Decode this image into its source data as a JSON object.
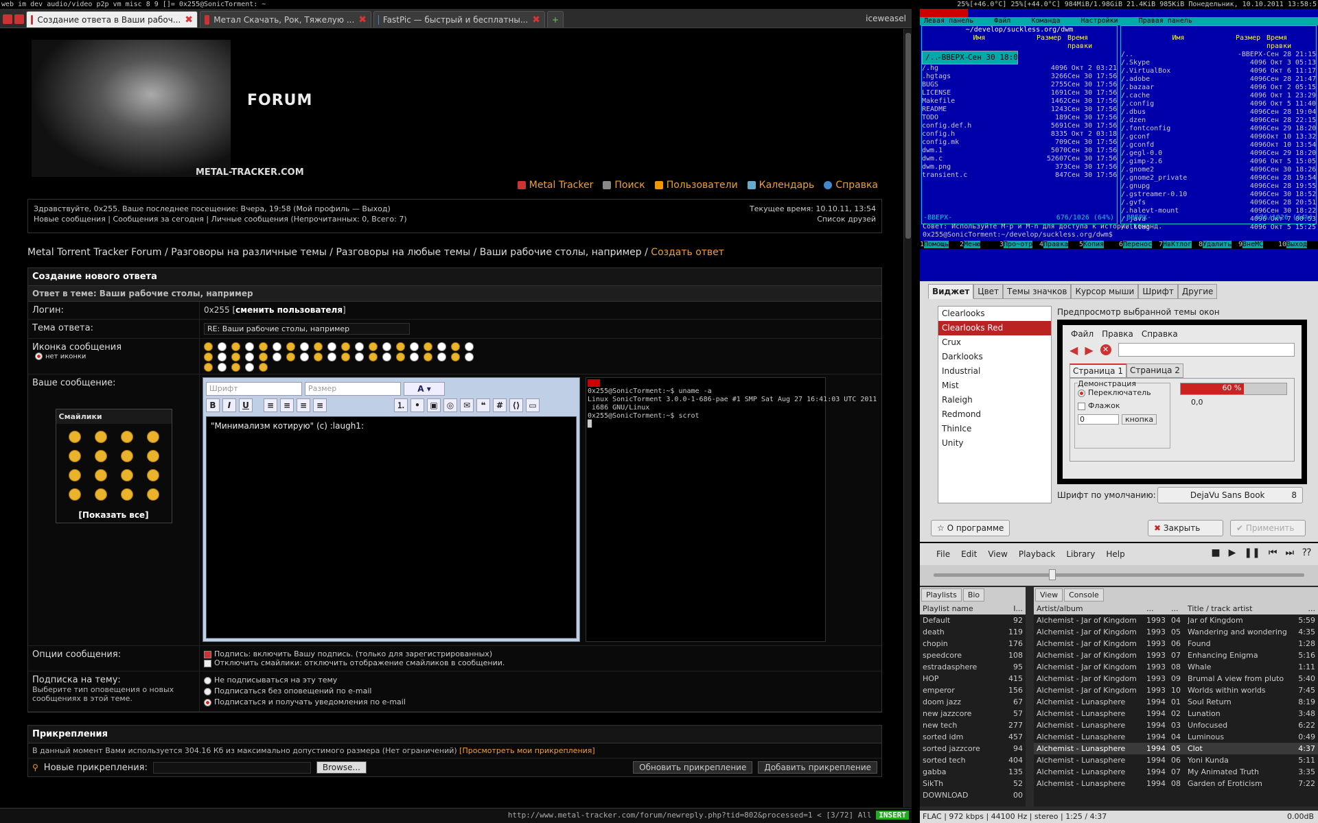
{
  "topbar": {
    "left": "web  im  dev  audio/video  p2p  vm  misc  8  9  []=  0x255@SonicTorment: ~",
    "right": "25%[+46.0°C]  25%[+44.0°C]  984MiB/1.98GiB  21.4KiB  985KiB  Понедельник, 10.10.2011  13:58:5"
  },
  "tabs": [
    {
      "label": "Создание ответа в Ваши рабоч..."
    },
    {
      "label": "Метал Скачать, Рок, Тяжелую ..."
    },
    {
      "label": "FastPic — быстрый и бесплатны..."
    }
  ],
  "browser_user": "iceweasel",
  "site": {
    "forum": "FORUM",
    "name": "METAL-TRACKER.COM"
  },
  "toplinks": [
    "Metal Tracker",
    "Поиск",
    "Пользователи",
    "Календарь",
    "Справка"
  ],
  "welcome": {
    "line1": "Здравствуйте, 0x255. Ваше последнее посещение: Вчера, 19:58 (Мой профиль — Выход)",
    "line2": "Новые сообщения | Сообщения за сегодня | Личные сообщения (Непрочитанных: 0, Всего: 7)",
    "time": "Текущее время: 10.10.11, 13:54",
    "friends": "Список друзей"
  },
  "breadcrumbs": [
    "Metal Torrent Tracker Forum",
    "Разговоры на различные темы",
    "Разговоры на любые темы",
    "Ваши рабочие столы, например"
  ],
  "breadcrumb_current": "Создать ответ",
  "form": {
    "title": "Создание нового ответа",
    "subtitle": "Ответ в теме: Ваши рабочие столы, например",
    "login_label": "Логин:",
    "login_value": "0x255",
    "change_user": "сменить пользователя",
    "subject_label": "Тема ответа:",
    "subject_value": "RE: Ваши рабочие столы, например",
    "icon_label": "Иконка сообщения",
    "no_icon": "нет иконки",
    "message_label": "Ваше сообщение:",
    "font_placeholder": "Шрифт",
    "size_placeholder": "Размер",
    "message_text": "\"Минимализм котирую\" (c) :laugh1:",
    "smilies_title": "Смайлики",
    "show_all": "[Показать все]",
    "options_label": "Опции сообщения:",
    "opt_sig": "Подпись: включить Вашу подпись. (только для зарегистрированных)",
    "opt_nosmile": "Отключить смайлики: отключить отображение смайликов в сообщении.",
    "sub_label": "Подписка на тему:",
    "sub_desc": "Выберите тип оповещения о новых сообщениях в этой теме.",
    "sub_opts": [
      "Не подписываться на эту тему",
      "Подписаться без оповещений по e-mail",
      "Подписаться и получать уведомления по e-mail"
    ],
    "attach_title": "Прикрепления",
    "attach_info": "В данный момент Вами используется 304.16 Кб из максимально допустимого размера (Нет ограничений)",
    "attach_link": "[Просмотреть мои прикрепления]",
    "new_attach": "Новые прикрепления:",
    "browse": "Browse...",
    "update_btn": "Обновить прикрепление",
    "add_btn": "Добавить прикрепление"
  },
  "term_embedded": "0x255@SonicTorment:~$ uname -a\nLinux SonicTorment 3.0.0-1-686-pae #1 SMP Sat Aug 27 16:41:03 UTC 2011\n i686 GNU/Linux\n0x255@SonicTorment:~$ scrot\n█",
  "statusbar": {
    "url": "http://www.metal-tracker.com/forum/newreply.php?tid=802&processed=1 < [3/72] All",
    "mode": "INSERT"
  },
  "mc": {
    "menu": [
      "Левая панель",
      "Файл",
      "Команда",
      "Настройки",
      "Правая панель"
    ],
    "left_path": "~/develop/suckless.org/dwm",
    "left_files": [
      [
        "/..",
        "-ВВЕРХ-",
        "Сен 30 18:09"
      ],
      [
        "/.hg",
        "4096",
        "Окт  2 03:21"
      ],
      [
        ".hgtags",
        "3266",
        "Сен 30 17:56"
      ],
      [
        "BUGS",
        "2755",
        "Сен 30 17:56"
      ],
      [
        "LICENSE",
        "1691",
        "Сен 30 17:56"
      ],
      [
        "Makefile",
        "1462",
        "Сен 30 17:56"
      ],
      [
        "README",
        "1243",
        "Сен 30 17:56"
      ],
      [
        "TODO",
        "189",
        "Сен 30 17:56"
      ],
      [
        "config.def.h",
        "5691",
        "Сен 30 17:56"
      ],
      [
        "config.h",
        "8335",
        "Окт  2 03:18"
      ],
      [
        "config.mk",
        "709",
        "Сен 30 17:56"
      ],
      [
        "dwm.1",
        "5070",
        "Сен 30 17:56"
      ],
      [
        "dwm.c",
        "52607",
        "Сен 30 17:56"
      ],
      [
        "dwm.png",
        "373",
        "Сен 30 17:56"
      ],
      [
        "transient.c",
        "847",
        "Сен 30 17:56"
      ]
    ],
    "right_files": [
      [
        "/..",
        "-ВВЕРХ-",
        "Сен 28 21:15"
      ],
      [
        "/.Skype",
        "4096",
        "Окт  3 05:13"
      ],
      [
        "/.VirtualBox",
        "4096",
        "Окт  6 11:17"
      ],
      [
        "/.adobe",
        "4096",
        "Сен 28 21:47"
      ],
      [
        "/.bazaar",
        "4096",
        "Окт  2 05:15"
      ],
      [
        "/.cache",
        "4096",
        "Окт  1 23:29"
      ],
      [
        "/.config",
        "4096",
        "Окт  5 11:40"
      ],
      [
        "/.dbus",
        "4096",
        "Сен 28 19:04"
      ],
      [
        "/.dzen",
        "4096",
        "Сен 28 22:15"
      ],
      [
        "/.fontconfig",
        "4096",
        "Сен 29 18:20"
      ],
      [
        "/.gconf",
        "4096",
        "Окт 10 13:32"
      ],
      [
        "/.gconfd",
        "4096",
        "Окт 10 13:54"
      ],
      [
        "/.gegl-0.0",
        "4096",
        "Сен 29 18:20"
      ],
      [
        "/.gimp-2.6",
        "4096",
        "Окт  5 15:05"
      ],
      [
        "/.gnome2",
        "4096",
        "Сен 30 18:26"
      ],
      [
        "/.gnome2_private",
        "4096",
        "Сен 28 19:54"
      ],
      [
        "/.gnupg",
        "4096",
        "Сен 28 19:55"
      ],
      [
        "/.gstreamer-0.10",
        "4096",
        "Сен 30 18:52"
      ],
      [
        "/.gvfs",
        "4096",
        "Сен 28 20:51"
      ],
      [
        "/.halevt-mount",
        "4096",
        "Сен 30 18:22"
      ],
      [
        "/.java",
        "4096",
        "Окт  7 00:53"
      ],
      [
        "/.lltag",
        "4096",
        "Окт  5 15:25"
      ]
    ],
    "up": "-ВВЕРХ-",
    "count": "676/1026 (64%)",
    "hint": "Совет: Используйте M-p и M-n для доступа к истории команд.",
    "prompt": "0x255@SonicTorment:~/develop/suckless.org/dwm$",
    "fkeys": [
      "Помощь",
      "Меню",
      "Про~отр",
      "Правка",
      "Копия",
      "Перенос",
      "НвКтлог",
      "Удалить",
      "ВнеМС",
      "Выход"
    ]
  },
  "lxap": {
    "tabs": [
      "Виджет",
      "Цвет",
      "Темы значков",
      "Курсор мыши",
      "Шрифт",
      "Другие"
    ],
    "themes": [
      "Clearlooks",
      "Clearlooks Red",
      "Crux",
      "Darklooks",
      "Industrial",
      "Mist",
      "Raleigh",
      "Redmond",
      "ThinIce",
      "Unity"
    ],
    "selected": "Clearlooks Red",
    "preview_label": "Предпросмотр выбранной темы окон",
    "prev_menu": [
      "Файл",
      "Правка",
      "Справка"
    ],
    "prev_tabs": [
      "Страница 1",
      "Страница 2"
    ],
    "demo": "Демонстрация",
    "radio": "Переключатель",
    "check": "Флажок",
    "spin": "0",
    "button": "кнопка",
    "progress": "60 %",
    "scale": "0,0",
    "font_label": "Шрифт по умолчанию:",
    "font_value": "DejaVu Sans Book",
    "font_size": "8",
    "about": "О программе",
    "close": "Закрыть",
    "apply": "Применить"
  },
  "deadbeef": {
    "menu": [
      "File",
      "Edit",
      "View",
      "Playback",
      "Library",
      "Help"
    ],
    "pl_tabs": [
      "Playlists",
      "Bio"
    ],
    "tr_tabs": [
      "View",
      "Console"
    ],
    "pl_header": [
      "Playlist name",
      "I..."
    ],
    "playlists": [
      [
        "Default",
        "92"
      ],
      [
        "death",
        "119"
      ],
      [
        "chopin",
        "176"
      ],
      [
        "speedcore",
        "108"
      ],
      [
        "estradasphere",
        "95"
      ],
      [
        "HOP",
        "415"
      ],
      [
        "emperor",
        "156"
      ],
      [
        "doom jazz",
        "67"
      ],
      [
        "new jazzcore",
        "57"
      ],
      [
        "new tech",
        "277"
      ],
      [
        "sorted idm",
        "457"
      ],
      [
        "sorted jazzcore",
        "94"
      ],
      [
        "sorted tech",
        "404"
      ],
      [
        "gabba",
        "135"
      ],
      [
        "SikTh",
        "52"
      ],
      [
        "DOWNLOAD",
        "00"
      ]
    ],
    "tr_header": [
      "Artist/album",
      "...",
      "...",
      "Title / track artist",
      "..."
    ],
    "tracks": [
      [
        "Alchemist - Jar of Kingdom",
        "1993",
        "04",
        "Jar of Kingdom",
        "5:59"
      ],
      [
        "Alchemist - Jar of Kingdom",
        "1993",
        "05",
        "Wandering and wondering",
        "4:35"
      ],
      [
        "Alchemist - Jar of Kingdom",
        "1993",
        "06",
        "Found",
        "1:28"
      ],
      [
        "Alchemist - Jar of Kingdom",
        "1993",
        "07",
        "Enhancing Enigma",
        "5:16"
      ],
      [
        "Alchemist - Jar of Kingdom",
        "1993",
        "08",
        "Whale",
        "1:11"
      ],
      [
        "Alchemist - Jar of Kingdom",
        "1993",
        "09",
        "Brumal A view from pluto",
        "5:40"
      ],
      [
        "Alchemist - Jar of Kingdom",
        "1993",
        "10",
        "Worlds within worlds",
        "7:45"
      ],
      [
        "Alchemist - Lunasphere",
        "1994",
        "01",
        "Soul Return",
        "8:19"
      ],
      [
        "Alchemist - Lunasphere",
        "1994",
        "02",
        "Lunation",
        "3:48"
      ],
      [
        "Alchemist - Lunasphere",
        "1994",
        "03",
        "Unfocused",
        "6:22"
      ],
      [
        "Alchemist - Lunasphere",
        "1994",
        "04",
        "Luminous",
        "0:49"
      ],
      [
        "Alchemist - Lunasphere",
        "1994",
        "05",
        "Clot",
        "4:37"
      ],
      [
        "Alchemist - Lunasphere",
        "1994",
        "06",
        "Yoni Kunda",
        "5:11"
      ],
      [
        "Alchemist - Lunasphere",
        "1994",
        "07",
        "My Animated Truth",
        "3:35"
      ],
      [
        "Alchemist - Lunasphere",
        "1994",
        "08",
        "Garden of Eroticism",
        "7:22"
      ]
    ],
    "status": "FLAC | 972 kbps | 44100 Hz | stereo | 1:25 / 4:37",
    "volume": "0.00dB"
  }
}
